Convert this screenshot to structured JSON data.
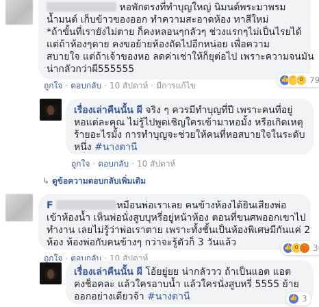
{
  "comment1": {
    "author_suffix": "",
    "lines": [
      "หอพักตรงที่ทำบุญใหญ่ นิมนต์พระมาพรม",
      "น้ำมนต์ เก็บข้าวของออก ทำความสะอาดห้อง ทาสีใหม่",
      "*ถ้าขั้นที่เรายังไม่ตาย ก็คงหลอนๆกลัวๆ ช่วงแรกๆไม่เป็นไรยได้",
      "แต่ถ้าห้องๆตาย คงขอย้ายห้องถัดไปอีกหน่อย เพื่อความ",
      "สบายใจ แต่ถ้าเจ้าของหอ ลดค่าเช่าให้ก็ยุต่อไป เพราะความจนมัน",
      "น่ากลัวกว่าผี555555"
    ],
    "actions": {
      "like": "ถูกใจ",
      "reply": "ตอบกลับ",
      "time": "10 สัปดาห์",
      "edited": "มีการแก้ไข"
    },
    "reactions": {
      "icons": [
        "like-icon",
        "haha-icon",
        "wow-icon"
      ],
      "count": "79"
    }
  },
  "reply1": {
    "author": "เรื่องเล่าคืนนั้น ผี",
    "lines": [
      " จริง ๆ ควรมีทำบุญที่ปี เพราะคนที่อยู่",
      "หอแต่ละคุณ ไม่รู้ไปพูดเชิญใครเข้ามาหอมั้ง หรือเกิดเหตุ",
      "ร้ายอะไรมั้ง การทำบุญจะช่วยให้คนที่หอสบายใจในระดับ",
      "หนึ่ง "
    ],
    "hashtag": "#นางตานี",
    "actions": {
      "like": "ถูกใจ",
      "reply": "ตอบกลับ",
      "time": "10 สัปดาห์"
    }
  },
  "more_replies": "ดูข้อความตอบกลับเพิ่มเติม",
  "comment2": {
    "author_initial": "F",
    "lines": [
      "หมือนพ่อเราเลย คนข้างห้องได้ยินเสียงพ่อ",
      "เข้าห้องน้ำ เห็นพ่อนั่งสูบบุหรี่อยู่หน้าห้อง ตอนที่ขนศพออกเขาไป",
      "ทำงาน เลยไม่รู้ว่าพ่อเราตาย เพราะทั้งชั้นเป็นห้องพิเศษมีกันแค่ 2",
      "ห้อง ห้องพ่อกับคนข้างๆ กว่าจะรู้ตัวก็ 3 วันแล้ว"
    ],
    "actions": {
      "like": "ถูกใจ",
      "reply": "ตอบกลับ",
      "time": "10 สัปดาห์"
    },
    "reactions": {
      "icons": [
        "like-icon",
        "wow-icon",
        "angry-icon"
      ],
      "count": "30"
    }
  },
  "reply2": {
    "author": "เรื่องเล่าคืนนั้น ผี",
    "lines": [
      " โอ้ยยู่ยย น่ากลัววว ถ้าเป็นแอต แอต",
      "คงช็อคละ แล้วใครอาบน้ำ แล้วใครนั่งสูบหรี่ 5555 ย้าย",
      "ออกอย่างเดียวจ้า "
    ],
    "hashtag": "#นางตานี",
    "actions": {
      "like": "ถูกใจ",
      "reply": "ตอบกลับ",
      "time": "10 สัปดาห์"
    },
    "reactions": {
      "icons": [
        "like-icon"
      ],
      "count": "3"
    }
  },
  "colors": {
    "link": "#385898",
    "bubble": "#f2f3f5",
    "meta": "#90949c"
  }
}
